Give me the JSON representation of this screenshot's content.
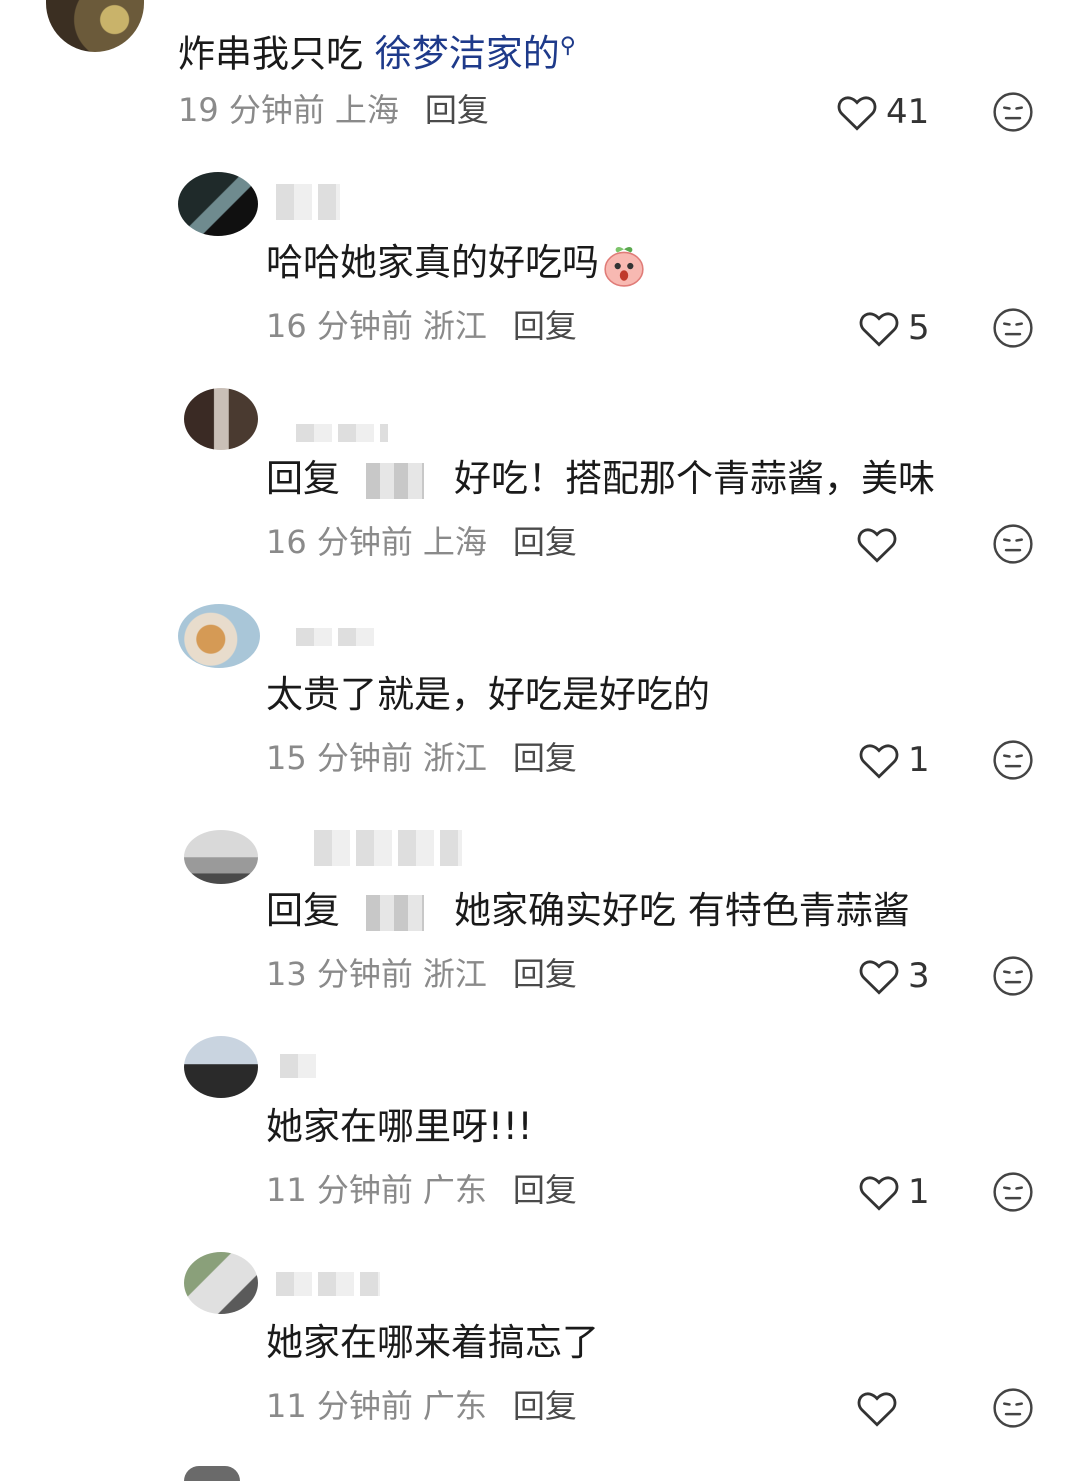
{
  "comments": [
    {
      "text_before": "炸串我只吃",
      "mention": "徐梦洁家的",
      "time": "19 分钟前",
      "location": "上海",
      "reply_label": "回复",
      "likes": "41"
    },
    {
      "text": "哈哈她家真的好吃吗",
      "time": "16 分钟前",
      "location": "浙江",
      "reply_label": "回复",
      "likes": "5"
    },
    {
      "prefix": "回复",
      "text": "好吃！搭配那个青蒜酱，美味",
      "time": "16 分钟前",
      "location": "上海",
      "reply_label": "回复",
      "likes": ""
    },
    {
      "text": "太贵了就是，好吃是好吃的",
      "time": "15 分钟前",
      "location": "浙江",
      "reply_label": "回复",
      "likes": "1"
    },
    {
      "prefix": "回复",
      "text": "她家确实好吃 有特色青蒜酱",
      "time": "13 分钟前",
      "location": "浙江",
      "reply_label": "回复",
      "likes": "3"
    },
    {
      "text": "她家在哪里呀!!!",
      "time": "11 分钟前",
      "location": "广东",
      "reply_label": "回复",
      "likes": "1"
    },
    {
      "text": "她家在哪来着搞忘了",
      "time": "11 分钟前",
      "location": "广东",
      "reply_label": "回复",
      "likes": ""
    }
  ],
  "icons": {
    "like": "heart-outline-icon",
    "dislike": "neutral-face-icon",
    "search": "search-icon",
    "emoji": "peach-emoji"
  },
  "colors": {
    "mention": "#1e3a8a",
    "meta": "#8a8a8a",
    "text": "#1a1a1a"
  }
}
